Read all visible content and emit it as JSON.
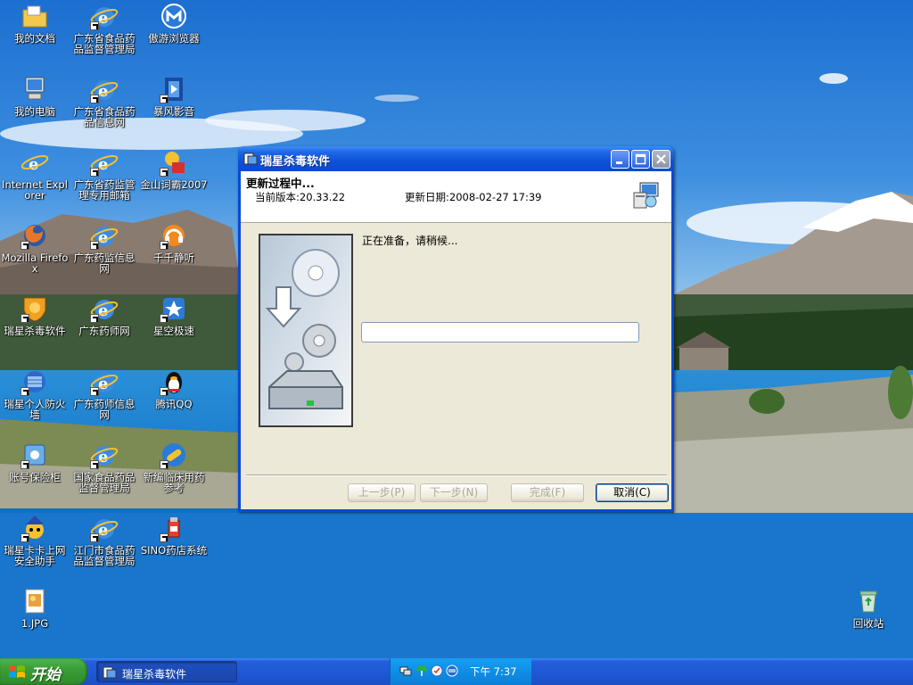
{
  "desktop": {
    "icons": [
      {
        "label": "我的文档"
      },
      {
        "label": "广东省食品药品监督管理局"
      },
      {
        "label": "傲游浏览器"
      },
      {
        "label": "我的电脑"
      },
      {
        "label": "广东省食品药品信息网"
      },
      {
        "label": "暴风影音"
      },
      {
        "label": "Internet Explorer"
      },
      {
        "label": "广东省药监管理专用邮箱"
      },
      {
        "label": "金山词霸2007"
      },
      {
        "label": "Mozilla Firefox"
      },
      {
        "label": "广东药监信息网"
      },
      {
        "label": "千千静听"
      },
      {
        "label": "瑞星杀毒软件"
      },
      {
        "label": "广东药师网"
      },
      {
        "label": "星空极速"
      },
      {
        "label": "瑞星个人防火墙"
      },
      {
        "label": "广东药师信息网"
      },
      {
        "label": "腾讯QQ"
      },
      {
        "label": "账号保险柜"
      },
      {
        "label": "国家食品药品监督管理局"
      },
      {
        "label": "新编临床用药参考"
      },
      {
        "label": "瑞星卡卡上网安全助手"
      },
      {
        "label": "江门市食品药品监督管理局"
      },
      {
        "label": "SINO药店系统"
      },
      {
        "label": "1.JPG"
      },
      {
        "label": "回收站"
      }
    ]
  },
  "window": {
    "title": "瑞星杀毒软件",
    "header_title": "更新过程中...",
    "version_label": "当前版本:20.33.22",
    "date_label": "更新日期:2008-02-27 17:39",
    "status": "正在准备，请稍候...",
    "progress": 0,
    "buttons": {
      "prev": "上一步(P)",
      "next": "下一步(N)",
      "finish": "完成(F)",
      "cancel": "取消(C)"
    }
  },
  "taskbar": {
    "start_label": "开始",
    "task_label": "瑞星杀毒软件",
    "clock": "下午 7:37"
  },
  "colors": {
    "titlebar": "#0a4cd0",
    "start": "#3a9e36",
    "tray": "#0f8ee6"
  }
}
